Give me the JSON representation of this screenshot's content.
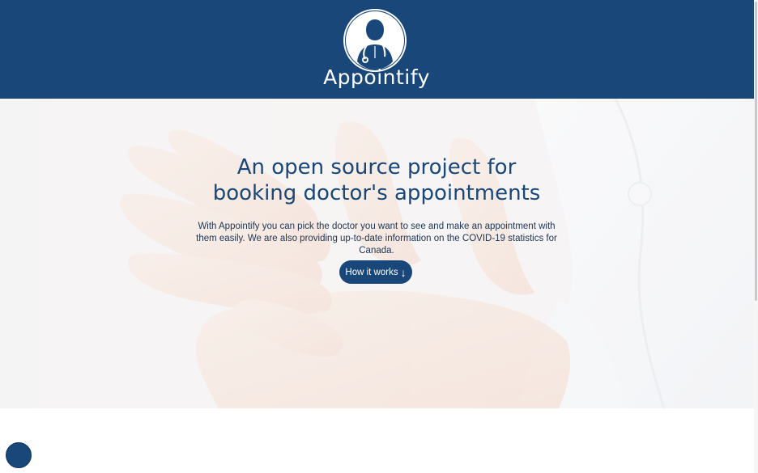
{
  "header": {
    "brand_name": "Appointify",
    "logo_icon": "doctor-stethoscope-icon"
  },
  "hero": {
    "title_line1": "An open source project for",
    "title_line2": "booking doctor's appointments",
    "description": "With Appointify you can pick the doctor you want to see and make an appointment with them easily. We are also providing up-to-date information on the COVID-19 statistics for Canada.",
    "button_label": "How it works",
    "button_icon": "arrow-down-icon",
    "background": "hands-photo"
  },
  "colors": {
    "brand": "#19477a",
    "header_bg": "#19477a",
    "text_dark": "#1d3553",
    "hero_bg": "#f1eeee"
  }
}
